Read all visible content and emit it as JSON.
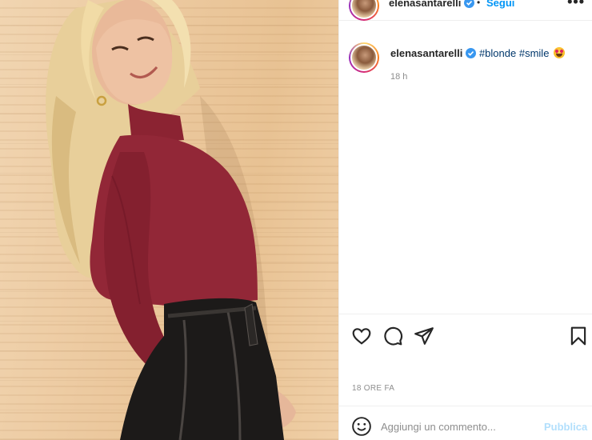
{
  "post": {
    "username": "elenasantarelli",
    "verified": true,
    "follow_label": "Segui",
    "separator": "•",
    "more_label": "•••"
  },
  "caption": {
    "username": "elenasantarelli",
    "hashtags": [
      "#blonde",
      "#smile"
    ],
    "emoji_icon": "star-struck-emoji",
    "time": "18 h"
  },
  "actions": {
    "icons": [
      "like-heart-icon",
      "comment-bubble-icon",
      "share-paper-plane-icon",
      "save-bookmark-icon"
    ],
    "date": "18 ORE FA"
  },
  "comment_box": {
    "placeholder": "Aggiungi un commento...",
    "post_label": "Pubblica",
    "emoji_icon": "smiley-icon"
  },
  "colors": {
    "accent_blue": "#0095f6",
    "post_disabled": "#b2dffc",
    "hashtag": "#00376b",
    "secondary_text": "#8e8e8e"
  }
}
